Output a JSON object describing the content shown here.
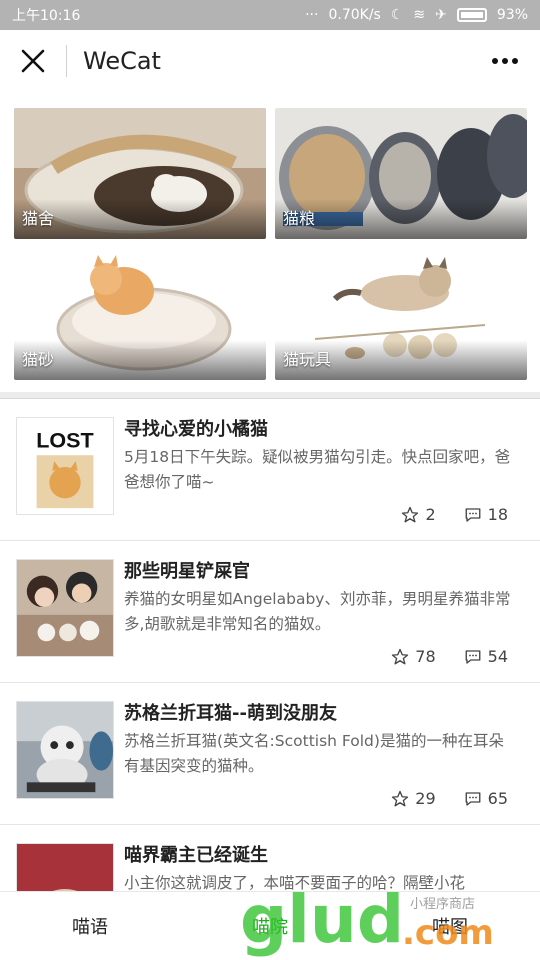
{
  "status_bar": {
    "time": "上午10:16",
    "speed": "0.70K/s",
    "battery": "93%"
  },
  "nav": {
    "title": "WeCat",
    "close_icon": "close-icon",
    "more_icon": "more-icon"
  },
  "categories": [
    {
      "label": "猫舍"
    },
    {
      "label": "猫粮"
    },
    {
      "label": "猫砂"
    },
    {
      "label": "猫玩具"
    }
  ],
  "articles": [
    {
      "title": "寻找心爱的小橘猫",
      "desc": "5月18日下午失踪。疑似被男猫勾引走。快点回家吧，爸爸想你了喵~",
      "thumb_text": "LOST",
      "stars": "2",
      "comments": "18"
    },
    {
      "title": "那些明星铲屎官",
      "desc": "养猫的女明星如Angelababy、刘亦菲，男明星养猫非常多,胡歌就是非常知名的猫奴。",
      "stars": "78",
      "comments": "54"
    },
    {
      "title": "苏格兰折耳猫--萌到没朋友",
      "desc": "苏格兰折耳猫(英文名:Scottish Fold)是猫的一种在耳朵有基因突变的猫种。",
      "stars": "29",
      "comments": "65"
    },
    {
      "title": "喵界霸主已经诞生",
      "desc": "小主你这就调皮了，本喵不要面子的哈？隔壁小花"
    }
  ],
  "tabs": [
    {
      "label": "喵语"
    },
    {
      "label": "喵院"
    },
    {
      "label": "喵图"
    }
  ],
  "watermark": {
    "brand": "glud.com",
    "sub": "小程序商店"
  },
  "colors": {
    "active_tab": "#1aad19",
    "statusbar_bg": "#b3b3b3"
  }
}
